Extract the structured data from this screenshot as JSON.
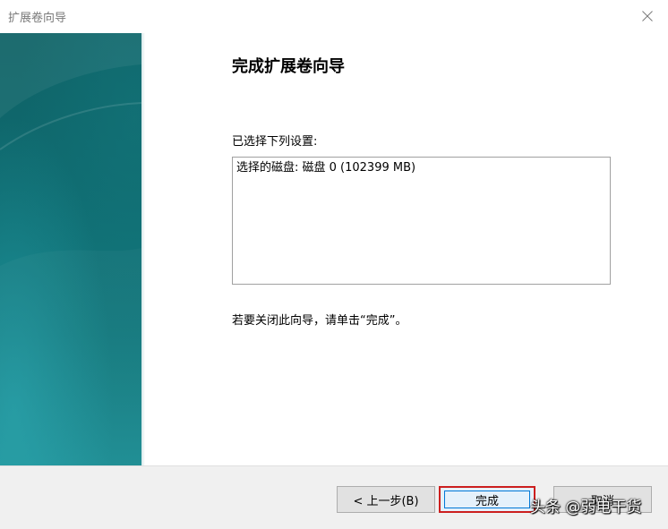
{
  "window": {
    "title": "扩展卷向导"
  },
  "main": {
    "heading": "完成扩展卷向导",
    "settings_label": "已选择下列设置:",
    "settings": [
      "选择的磁盘: 磁盘 0 (102399 MB)"
    ],
    "close_hint": "若要关闭此向导，请单击“完成”。"
  },
  "footer": {
    "back_label": "< 上一步(B)",
    "finish_label": "完成",
    "cancel_label": "取消"
  },
  "watermark": "头条 @弱电干货",
  "colors": {
    "banner": "#0f6a6f",
    "highlight_border": "#cc1f1f",
    "footer_bg": "#f0f0f0"
  },
  "icons": {
    "close": "close-icon"
  }
}
